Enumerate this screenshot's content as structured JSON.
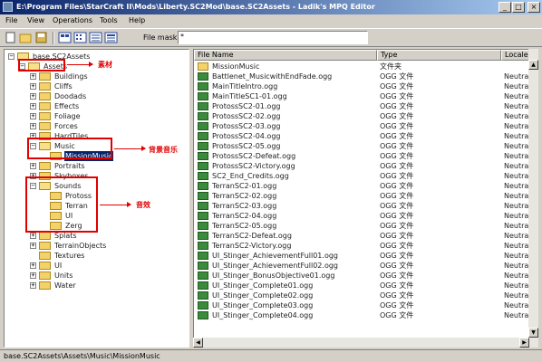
{
  "window": {
    "title": "E:\\Program Files\\StarCraft II\\Mods\\Liberty.SC2Mod\\base.SC2Assets - Ladik's MPQ Editor"
  },
  "menu": [
    "File",
    "View",
    "Operations",
    "Tools",
    "Help"
  ],
  "toolbar": {
    "icons": [
      "new-icon",
      "open-icon",
      "save-icon",
      "view-large-icon",
      "view-small-icon",
      "view-list-icon",
      "view-details-icon"
    ],
    "file_mask_label": "File mask:",
    "file_mask_value": "*"
  },
  "tree": {
    "nodes": [
      {
        "label": "base.SC2Assets",
        "depth": 0,
        "expanded": true
      },
      {
        "label": "Assets",
        "depth": 1,
        "expanded": true
      },
      {
        "label": "Buildings",
        "depth": 2,
        "expanded": false
      },
      {
        "label": "Cliffs",
        "depth": 2,
        "expanded": false
      },
      {
        "label": "Doodads",
        "depth": 2,
        "expanded": false
      },
      {
        "label": "Effects",
        "depth": 2,
        "expanded": false
      },
      {
        "label": "Foliage",
        "depth": 2,
        "expanded": false
      },
      {
        "label": "Forces",
        "depth": 2,
        "expanded": false
      },
      {
        "label": "HardTiles",
        "depth": 2,
        "expanded": false
      },
      {
        "label": "Music",
        "depth": 2,
        "expanded": true
      },
      {
        "label": "MissionMusic",
        "depth": 3,
        "expanded": false,
        "selected": true
      },
      {
        "label": "Portraits",
        "depth": 2,
        "expanded": false
      },
      {
        "label": "Skyboxes",
        "depth": 2,
        "expanded": false
      },
      {
        "label": "Sounds",
        "depth": 2,
        "expanded": true
      },
      {
        "label": "Protoss",
        "depth": 3,
        "expanded": false
      },
      {
        "label": "Terran",
        "depth": 3,
        "expanded": false
      },
      {
        "label": "UI",
        "depth": 3,
        "expanded": false
      },
      {
        "label": "Zerg",
        "depth": 3,
        "expanded": false
      },
      {
        "label": "Splats",
        "depth": 2,
        "expanded": false
      },
      {
        "label": "TerrainObjects",
        "depth": 2,
        "expanded": false
      },
      {
        "label": "Textures",
        "depth": 2,
        "expanded": false
      },
      {
        "label": "UI",
        "depth": 2,
        "expanded": false
      },
      {
        "label": "Units",
        "depth": 2,
        "expanded": false
      },
      {
        "label": "Water",
        "depth": 2,
        "expanded": false
      }
    ]
  },
  "annotations": {
    "assets": "素材",
    "music": "背景音乐",
    "sounds": "音效"
  },
  "annotation_color": "#e00000",
  "list": {
    "columns": [
      "File Name",
      "Type",
      "Locale"
    ],
    "rows": [
      {
        "name": "MissionMusic",
        "type": "文件夹",
        "locale": "",
        "kind": "dir"
      },
      {
        "name": "Battlenet_MusicwithEndFade.ogg",
        "type": "OGG 文件",
        "locale": "Neutral",
        "kind": "ogg"
      },
      {
        "name": "MainTitleIntro.ogg",
        "type": "OGG 文件",
        "locale": "Neutral",
        "kind": "ogg"
      },
      {
        "name": "MainTitleSC1-01.ogg",
        "type": "OGG 文件",
        "locale": "Neutral",
        "kind": "ogg"
      },
      {
        "name": "ProtossSC2-01.ogg",
        "type": "OGG 文件",
        "locale": "Neutral",
        "kind": "ogg"
      },
      {
        "name": "ProtossSC2-02.ogg",
        "type": "OGG 文件",
        "locale": "Neutral",
        "kind": "ogg"
      },
      {
        "name": "ProtossSC2-03.ogg",
        "type": "OGG 文件",
        "locale": "Neutral",
        "kind": "ogg"
      },
      {
        "name": "ProtossSC2-04.ogg",
        "type": "OGG 文件",
        "locale": "Neutral",
        "kind": "ogg"
      },
      {
        "name": "ProtossSC2-05.ogg",
        "type": "OGG 文件",
        "locale": "Neutral",
        "kind": "ogg"
      },
      {
        "name": "ProtossSC2-Defeat.ogg",
        "type": "OGG 文件",
        "locale": "Neutral",
        "kind": "ogg"
      },
      {
        "name": "ProtossSC2-Victory.ogg",
        "type": "OGG 文件",
        "locale": "Neutral",
        "kind": "ogg"
      },
      {
        "name": "SC2_End_Credits.ogg",
        "type": "OGG 文件",
        "locale": "Neutral",
        "kind": "ogg"
      },
      {
        "name": "TerranSC2-01.ogg",
        "type": "OGG 文件",
        "locale": "Neutral",
        "kind": "ogg"
      },
      {
        "name": "TerranSC2-02.ogg",
        "type": "OGG 文件",
        "locale": "Neutral",
        "kind": "ogg"
      },
      {
        "name": "TerranSC2-03.ogg",
        "type": "OGG 文件",
        "locale": "Neutral",
        "kind": "ogg"
      },
      {
        "name": "TerranSC2-04.ogg",
        "type": "OGG 文件",
        "locale": "Neutral",
        "kind": "ogg"
      },
      {
        "name": "TerranSC2-05.ogg",
        "type": "OGG 文件",
        "locale": "Neutral",
        "kind": "ogg"
      },
      {
        "name": "TerranSC2-Defeat.ogg",
        "type": "OGG 文件",
        "locale": "Neutral",
        "kind": "ogg"
      },
      {
        "name": "TerranSC2-Victory.ogg",
        "type": "OGG 文件",
        "locale": "Neutral",
        "kind": "ogg"
      },
      {
        "name": "UI_Stinger_AchievementFull01.ogg",
        "type": "OGG 文件",
        "locale": "Neutral",
        "kind": "ogg"
      },
      {
        "name": "UI_Stinger_AchievementFull02.ogg",
        "type": "OGG 文件",
        "locale": "Neutral",
        "kind": "ogg"
      },
      {
        "name": "UI_Stinger_BonusObjective01.ogg",
        "type": "OGG 文件",
        "locale": "Neutral",
        "kind": "ogg"
      },
      {
        "name": "UI_Stinger_Complete01.ogg",
        "type": "OGG 文件",
        "locale": "Neutral",
        "kind": "ogg"
      },
      {
        "name": "UI_Stinger_Complete02.ogg",
        "type": "OGG 文件",
        "locale": "Neutral",
        "kind": "ogg"
      },
      {
        "name": "UI_Stinger_Complete03.ogg",
        "type": "OGG 文件",
        "locale": "Neutral",
        "kind": "ogg"
      },
      {
        "name": "UI_Stinger_Complete04.ogg",
        "type": "OGG 文件",
        "locale": "Neutral",
        "kind": "ogg"
      }
    ]
  },
  "status": {
    "path": "base.SC2Assets\\Assets\\Music\\MissionMusic"
  }
}
